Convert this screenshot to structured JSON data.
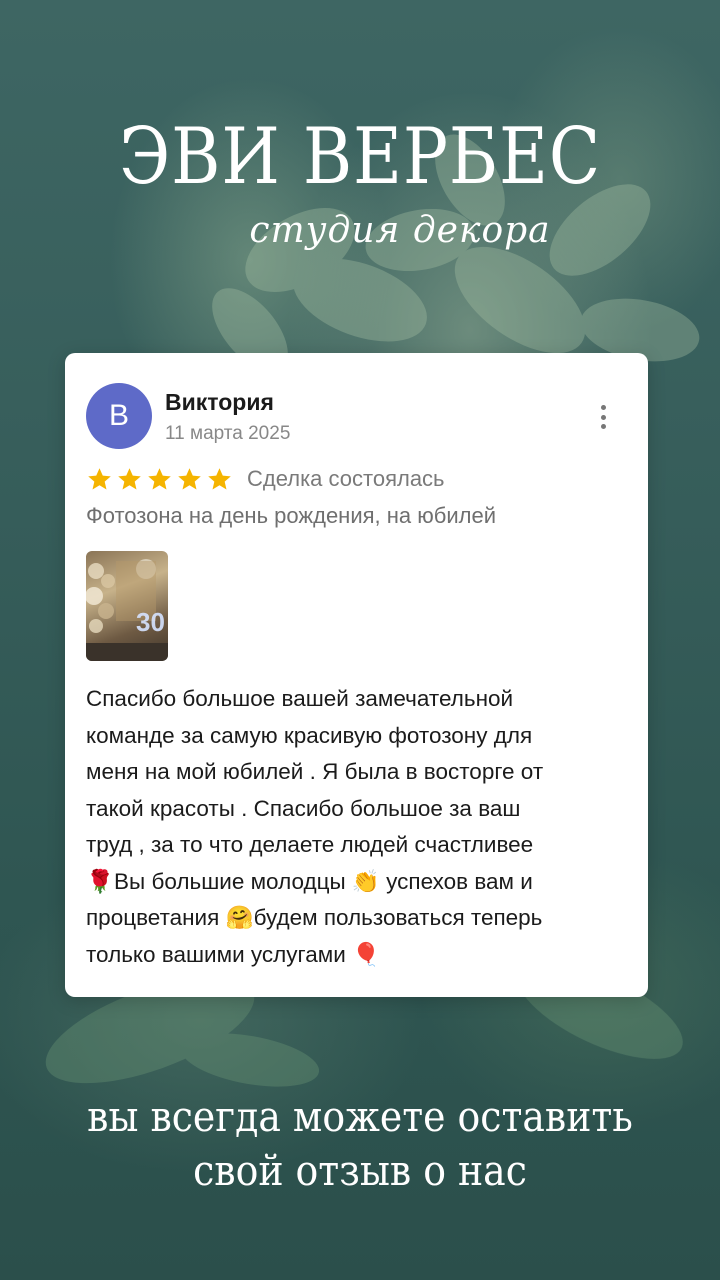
{
  "header": {
    "title": "ЭВИ ВЕРБЕС",
    "subtitle": "студия декора"
  },
  "review": {
    "avatar_letter": "В",
    "avatar_color": "#5e6ac8",
    "author": "Виктория",
    "date": "11 марта 2025",
    "more_icon": "more-vertical-icon",
    "rating": 5,
    "rating_max": 5,
    "star_color": "#f5b400",
    "status": "Сделка состоялась",
    "service": "Фотозона на день рождения, на юбилей",
    "photo_alt": "30",
    "text_lines": [
      "Спасибо большое вашей замечательной",
      "команде за самую красивую фотозону для",
      "меня на мой юбилей . Я была в восторге от",
      "такой красоты . Спасибо большое за ваш",
      "труд , за то что делаете людей счастливее",
      "🌹Вы большие молодцы 👏 успехов вам и",
      "процветания 🤗будем пользоваться теперь",
      "только вашими услугами 🎈"
    ]
  },
  "footer": {
    "line1": "вы всегда можете оставить",
    "line2": "свой отзыв о нас"
  }
}
